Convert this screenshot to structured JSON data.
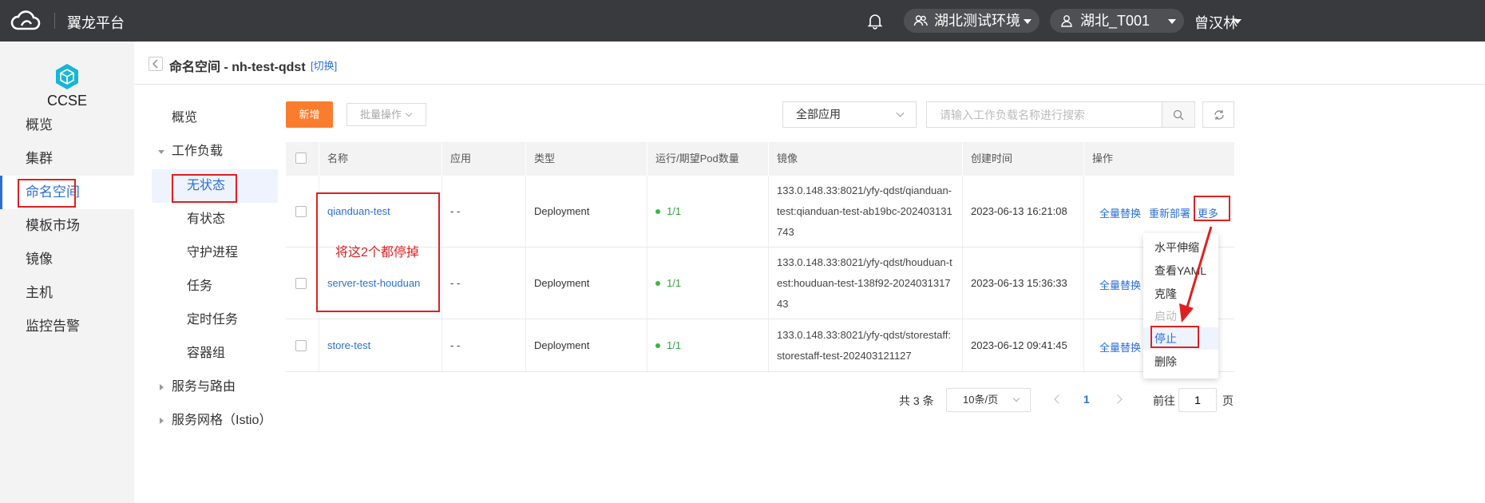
{
  "topbar": {
    "brand": "翼龙平台",
    "env_label": "湖北测试环境",
    "tenant_label": "湖北_T001",
    "user_name": "曾汉林"
  },
  "sidebar": {
    "product": "CCSE",
    "items": [
      {
        "label": "概览"
      },
      {
        "label": "集群"
      },
      {
        "label": "命名空间"
      },
      {
        "label": "模板市场"
      },
      {
        "label": "镜像"
      },
      {
        "label": "主机"
      },
      {
        "label": "监控告警"
      }
    ]
  },
  "breadcrumb": {
    "title": "命名空间 - nh-test-qdst",
    "switch": "[切换]"
  },
  "subnav": {
    "overview": "概览",
    "workload_group": "工作负载",
    "items": [
      {
        "label": "无状态"
      },
      {
        "label": "有状态"
      },
      {
        "label": "守护进程"
      },
      {
        "label": "任务"
      },
      {
        "label": "定时任务"
      },
      {
        "label": "容器组"
      }
    ],
    "service_group": "服务与路由",
    "mesh_group": "服务网格（Istio）"
  },
  "toolbar": {
    "new_label": "新增",
    "batch_label": "批量操作",
    "app_filter": "全部应用",
    "search_placeholder": "请输入工作负载名称进行搜索"
  },
  "table": {
    "headers": [
      "名称",
      "应用",
      "类型",
      "运行/期望Pod数量",
      "镜像",
      "创建时间",
      "操作"
    ],
    "rows": [
      {
        "name": "qianduan-test",
        "app": "- -",
        "type": "Deployment",
        "pods": "1/1",
        "image": "133.0.148.33:8021/yfy-qdst/qianduan-test:qianduan-test-ab19bc-202403131743",
        "created": "2023-06-13 16:21:08",
        "op_replace": "全量替换",
        "op_redeploy": "重新部署",
        "op_more": "更多"
      },
      {
        "name": "server-test-houduan",
        "app": "- -",
        "type": "Deployment",
        "pods": "1/1",
        "image": "133.0.148.33:8021/yfy-qdst/houduan-test:houduan-test-138f92-202403131743",
        "created": "2023-06-13 15:36:33",
        "op_replace": "全量替换"
      },
      {
        "name": "store-test",
        "app": "- -",
        "type": "Deployment",
        "pods": "1/1",
        "image": "133.0.148.33:8021/yfy-qdst/storestaff:storestaff-test-202403121127",
        "created": "2023-06-12 09:41:45",
        "op_replace": "全量替换"
      }
    ]
  },
  "more_menu": {
    "items": [
      {
        "label": "水平伸缩"
      },
      {
        "label": "查看YAML"
      },
      {
        "label": "克隆"
      },
      {
        "label": "启动"
      },
      {
        "label": "停止"
      },
      {
        "label": "删除"
      }
    ]
  },
  "annotation": "将这2个都停掉",
  "pagination": {
    "total": "共 3 条",
    "page_size": "10条/页",
    "current_page": "1",
    "goto_label": "前往",
    "goto_value": "1",
    "goto_unit": "页"
  },
  "colors": {
    "accent": "#2a6fd6",
    "primary_button": "#fa7d2d",
    "annotation_red": "#e02020",
    "topbar": "#393a3d"
  }
}
